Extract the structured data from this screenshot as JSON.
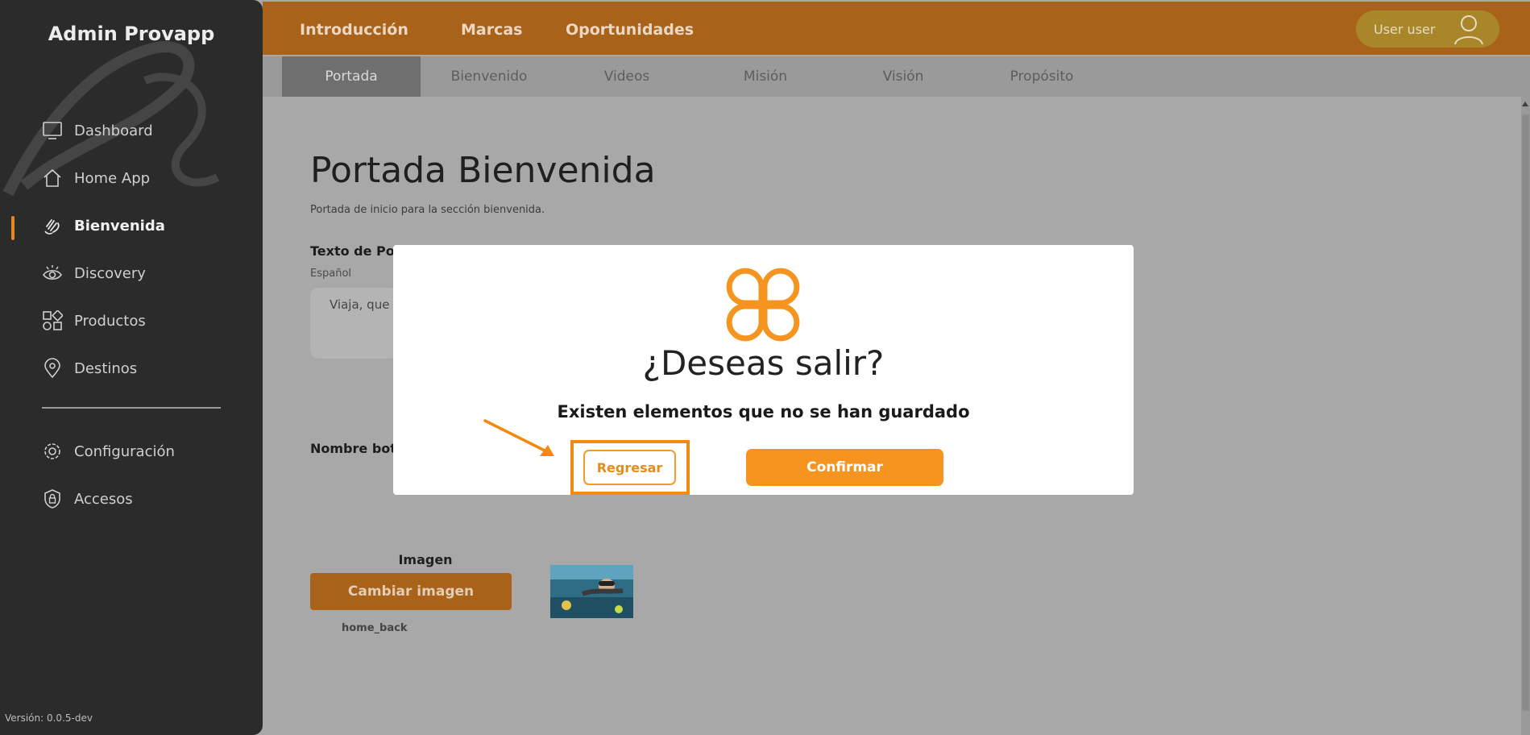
{
  "sidebar": {
    "brand": "Admin Provapp",
    "items": [
      {
        "label": "Dashboard",
        "icon": "monitor-icon"
      },
      {
        "label": "Home App",
        "icon": "home-icon"
      },
      {
        "label": "Bienvenida",
        "icon": "waving-hand-icon",
        "active": true
      },
      {
        "label": "Discovery",
        "icon": "eye-icon"
      },
      {
        "label": "Productos",
        "icon": "grid-shapes-icon"
      },
      {
        "label": "Destinos",
        "icon": "map-pin-icon"
      },
      {
        "label": "Configuración",
        "icon": "gear-icon"
      },
      {
        "label": "Accesos",
        "icon": "shield-lock-icon"
      }
    ],
    "version": "Versión: 0.0.5-dev"
  },
  "topbar": {
    "nav": [
      "Introducción",
      "Marcas",
      "Oportunidades"
    ],
    "user": "User user"
  },
  "subtabs": [
    "Portada",
    "Bienvenido",
    "Videos",
    "Misión",
    "Visión",
    "Propósito"
  ],
  "main": {
    "title": "Portada Bienvenida",
    "subtitle": "Portada de inicio para la sección bienvenida.",
    "text_label": "Texto de Por",
    "lang_label": "Español",
    "text_value": "Viaja, que l",
    "button_name_label": "Nombre botó",
    "image_label": "Imagen",
    "change_image": "Cambiar imagen",
    "image_file": "home_back"
  },
  "modal": {
    "title": "¿Deseas salir?",
    "message": "Existen elementos que no se han guardado",
    "back": "Regresar",
    "confirm": "Confirmar"
  },
  "colors": {
    "accent": "#f5951f",
    "topbar": "#a9621a",
    "sidebar": "#2b2b2b",
    "highlight": "#f48a12"
  }
}
